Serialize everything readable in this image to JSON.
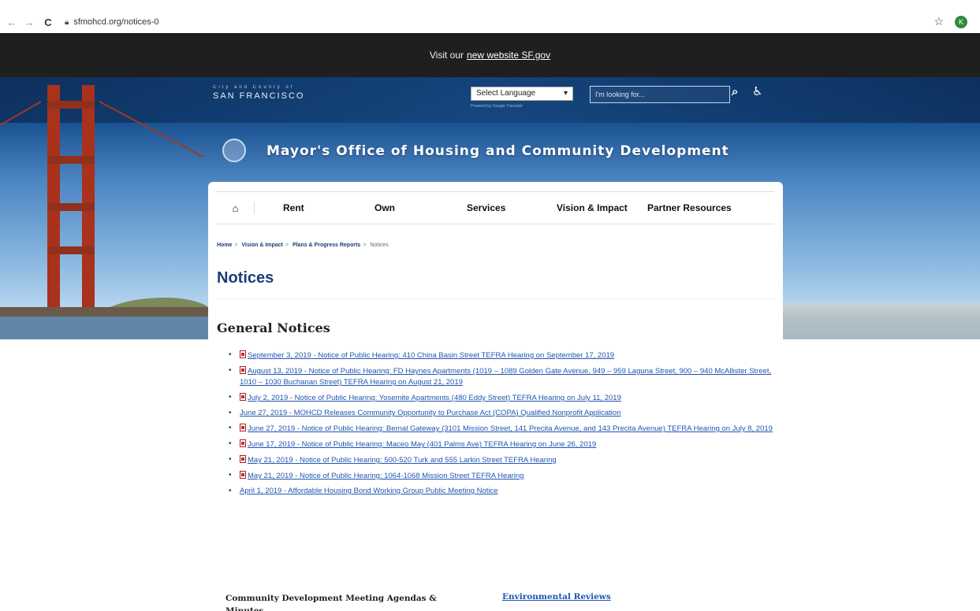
{
  "browser": {
    "url": "sfmohcd.org/notices-0",
    "profile_initial": "K"
  },
  "topbar": {
    "text": "Visit our",
    "link": "new website SF.gov"
  },
  "header": {
    "city_small": "City and County of",
    "city_big": "SAN FRANCISCO",
    "language_select": "Select Language",
    "powered_by": "Powered by Google Translate",
    "search_placeholder": "I'm looking for...",
    "org_title": "Mayor's Office of Housing and Community Development"
  },
  "nav": {
    "items": [
      "Rent",
      "Own",
      "Services",
      "Vision & Impact",
      "Partner Resources"
    ]
  },
  "breadcrumb": [
    "Home",
    "Vision & Impact",
    "Plans & Progress Reports",
    "Notices"
  ],
  "page_title": "Notices",
  "section_title": "General Notices",
  "notices": [
    "September 3, 2019 - Notice of Public Hearing: 410 China Basin Street TEFRA Hearing on September 17, 2019",
    "August 13, 2019 - Notice of Public Hearing: FD Haynes Apartments (1019 – 1089 Golden Gate Avenue, 949 – 959 Laguna Street, 900 – 940 McAllister Street, 1010 – 1030 Buchanan Street) TEFRA Hearing on August 21, 2019",
    "July 2, 2019 - Notice of Public Hearing: Yosemite Apartments (480 Eddy Street) TEFRA Hearing on July 11, 2019",
    "June 27, 2019 - MOHCD Releases Community Opportunity to Purchase Act (COPA) Qualified Nonprofit Application",
    "June 27, 2019 - Notice of Public Hearing: Bernal Gateway (3101 Mission Street, 141 Precita Avenue, and 143 Precita Avenue) TEFRA Hearing on July 8, 2019",
    "June 17, 2019 - Notice of Public Hearing: Maceo May (401 Palms Ave) TEFRA Hearing on June 26, 2019",
    "May 21, 2019 - Notice of Public Hearing: 500-520 Turk and 555 Larkin Street TEFRA Hearing",
    "May 21, 2019 - Notice of Public Hearing: 1064-1068 Mission Street TEFRA Hearing",
    "April 1, 2019 - Affordable Housing Bond Working Group Public Meeting Notice"
  ],
  "footer": {
    "left": "Community Development Meeting Agendas & Minutes",
    "right": "Environmental Reviews"
  }
}
